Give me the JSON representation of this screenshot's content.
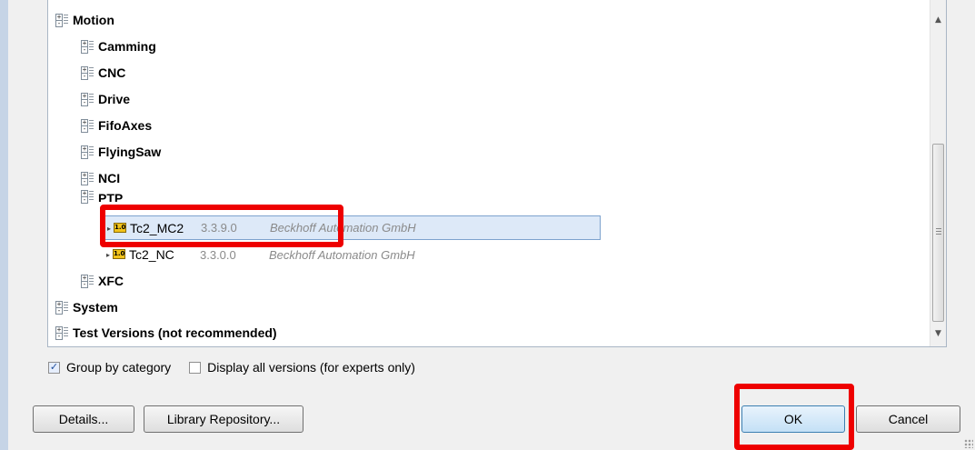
{
  "tree": {
    "motion": "Motion",
    "categories": [
      "Camming",
      "CNC",
      "Drive",
      "FifoAxes",
      "FlyingSaw",
      "NCI",
      "PTP"
    ],
    "libraries": [
      {
        "badge": "1.0",
        "name": "Tc2_MC2",
        "version": "3.3.9.0",
        "vendor": "Beckhoff Automation GmbH"
      },
      {
        "badge": "1.0",
        "name": "Tc2_NC",
        "version": "3.3.0.0",
        "vendor": "Beckhoff Automation GmbH"
      }
    ],
    "xfc": "XFC",
    "system": "System",
    "test_versions": "Test Versions (not recommended)"
  },
  "options": {
    "group_by_category": "Group by category",
    "display_all_versions": "Display all versions (for experts only)"
  },
  "buttons": {
    "details": "Details...",
    "library_repository": "Library Repository...",
    "ok": "OK",
    "cancel": "Cancel"
  }
}
